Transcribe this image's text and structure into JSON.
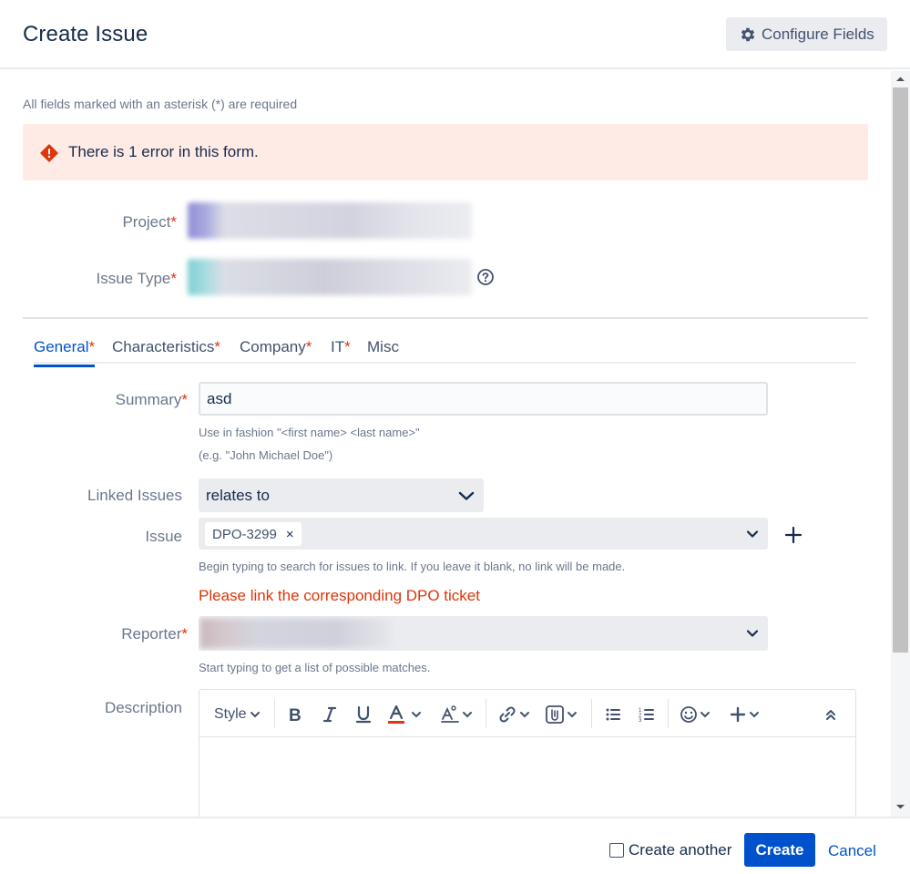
{
  "dialog": {
    "title": "Create Issue",
    "configure_fields_label": "Configure Fields"
  },
  "required_note": "All fields marked with an asterisk (*) are required",
  "error_banner": "There is 1 error in this form.",
  "project": {
    "label": "Project",
    "asterisk": "*"
  },
  "issue_type": {
    "label": "Issue Type",
    "asterisk": "*"
  },
  "tabs": [
    {
      "label": "General",
      "asterisk": "*",
      "active": true
    },
    {
      "label": "Characteristics",
      "asterisk": "*"
    },
    {
      "label": "Company",
      "asterisk": "*"
    },
    {
      "label": "IT",
      "asterisk": "*"
    },
    {
      "label": "Misc",
      "asterisk": ""
    }
  ],
  "summary": {
    "label": "Summary",
    "asterisk": "*",
    "value": "asd",
    "hint_line1": "Use in fashion \"<first name> <last name>\"",
    "hint_line2": "(e.g. \"John Michael Doe\")"
  },
  "linked_issues": {
    "label": "Linked Issues",
    "value": "relates to"
  },
  "issue": {
    "label": "Issue",
    "chip": "DPO-3299",
    "chip_remove": "×",
    "hint": "Begin typing to search for issues to link. If you leave it blank, no link will be made.",
    "error": "Please link the corresponding DPO ticket"
  },
  "reporter": {
    "label": "Reporter",
    "asterisk": "*",
    "hint": "Start typing to get a list of possible matches."
  },
  "description": {
    "label": "Description",
    "toolbar": {
      "style_label": "Style"
    }
  },
  "footer": {
    "create_another": "Create another",
    "create_label": "Create",
    "cancel_label": "Cancel"
  },
  "colors": {
    "primary": "#0052cc",
    "error": "#de350b",
    "error_bg": "#ffebe6",
    "text": "#172b4d",
    "subtle": "#6b778c"
  }
}
